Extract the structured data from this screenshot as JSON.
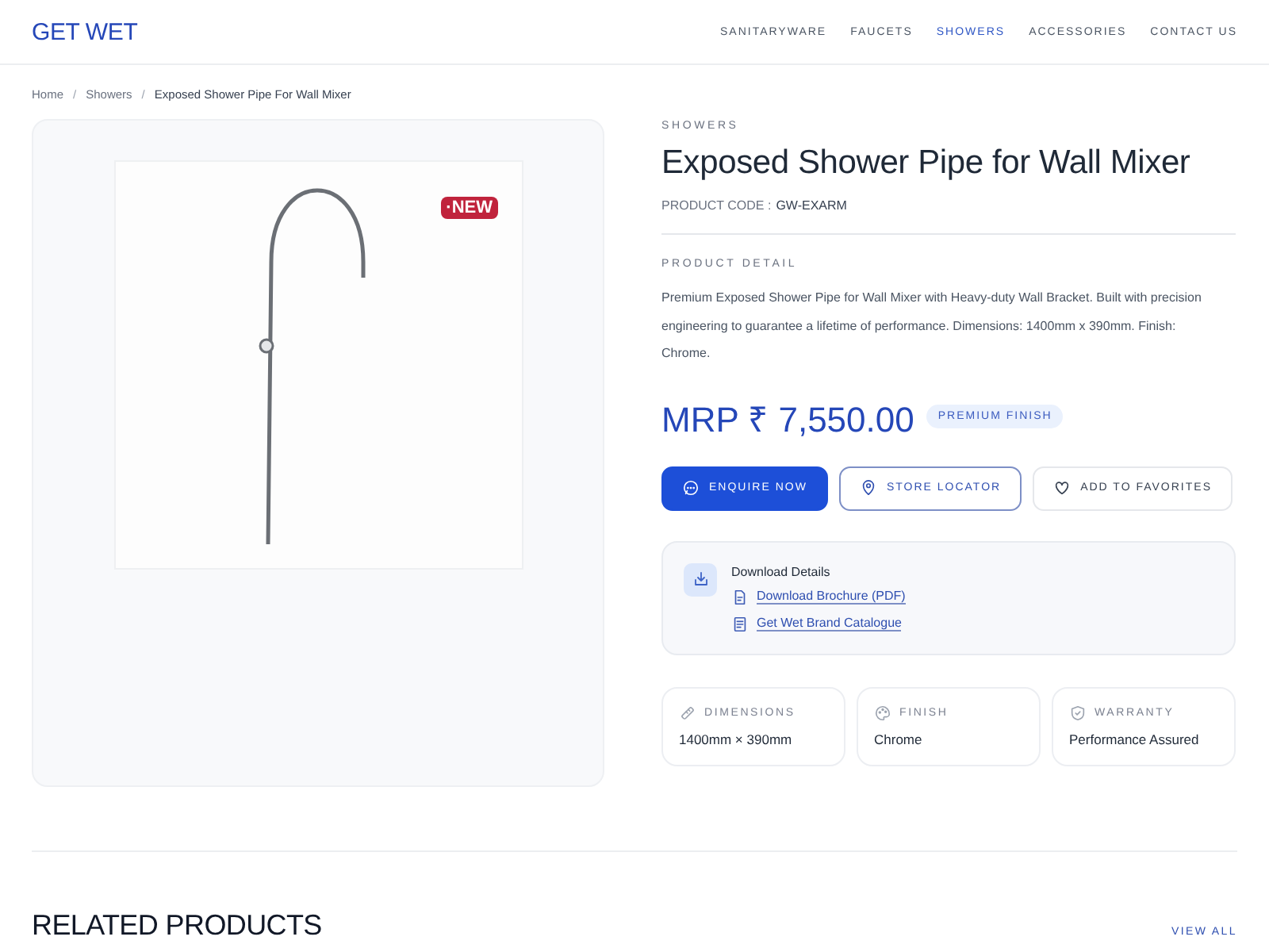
{
  "header": {
    "logo": "GET WET",
    "nav": [
      {
        "label": "SANITARYWARE",
        "selected": false
      },
      {
        "label": "FAUCETS",
        "selected": false
      },
      {
        "label": "SHOWERS",
        "selected": true
      },
      {
        "label": "ACCESSORIES",
        "selected": false
      },
      {
        "label": "CONTACT US",
        "selected": false
      }
    ]
  },
  "breadcrumb": [
    {
      "text": "Home",
      "kind": "link"
    },
    {
      "text": "/",
      "kind": "separator"
    },
    {
      "text": "Showers",
      "kind": "link"
    },
    {
      "text": "/",
      "kind": "separator"
    },
    {
      "text": "Exposed Shower Pipe For Wall Mixer",
      "kind": "current"
    }
  ],
  "gallery": {
    "badge": "·NEW"
  },
  "product": {
    "category": "SHOWERS",
    "title": "Exposed Shower Pipe for Wall Mixer",
    "code_label": "PRODUCT CODE :",
    "code": "GW-EXARM",
    "detail_heading": "PRODUCT DETAIL",
    "description": "Premium Exposed Shower Pipe for Wall Mixer with Heavy-duty Wall Bracket. Built with precision engineering to guarantee a lifetime of performance. Dimensions: 1400mm x 390mm. Finish: Chrome.",
    "price": "MRP ₹ 7,550.00",
    "price_tag": "PREMIUM FINISH",
    "buttons": [
      {
        "label": "ENQUIRE NOW",
        "kind": "primary"
      },
      {
        "label": "STORE LOCATOR",
        "kind": "outline"
      },
      {
        "label": "ADD TO FAVORITES",
        "kind": "plain"
      }
    ],
    "downloads": {
      "title": "Download Details",
      "links": [
        {
          "label": "Download Brochure (PDF)"
        },
        {
          "label": "Get Wet Brand Catalogue"
        }
      ]
    },
    "specs": [
      {
        "label": "DIMENSIONS",
        "value": "1400mm × 390mm"
      },
      {
        "label": "FINISH",
        "value": "Chrome"
      },
      {
        "label": "WARRANTY",
        "value": "Performance Assured"
      }
    ]
  },
  "related": {
    "title": "RELATED PRODUCTS",
    "link": "VIEW ALL"
  }
}
